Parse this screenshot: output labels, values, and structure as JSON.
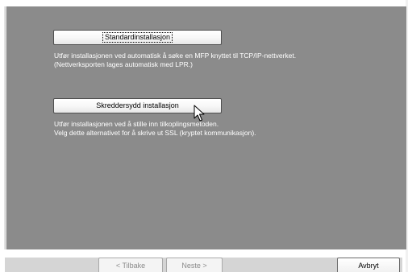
{
  "options": {
    "standard": {
      "button_label": "Standardinstallasjon",
      "description_line1": "Utfør installasjonen ved automatisk å søke en MFP knyttet til TCP/IP-nettverket.",
      "description_line2": "(Nettverksporten lages automatisk med LPR.)"
    },
    "custom": {
      "button_label": "Skreddersydd installasjon",
      "description_line1": "Utfør installasjonen ved å stille inn tilkoplingsmetoden.",
      "description_line2": "Velg dette alternativet for å skrive ut SSL (kryptet kommunikasjon)."
    }
  },
  "navigation": {
    "back_label": "< Tilbake",
    "next_label": "Neste >",
    "cancel_label": "Avbryt"
  },
  "colors": {
    "panel_background": "#8b8b8b",
    "description_text": "#ffffff",
    "disabled_text": "#8a8a8a"
  },
  "icons": {
    "cursor": "arrow-pointer"
  }
}
